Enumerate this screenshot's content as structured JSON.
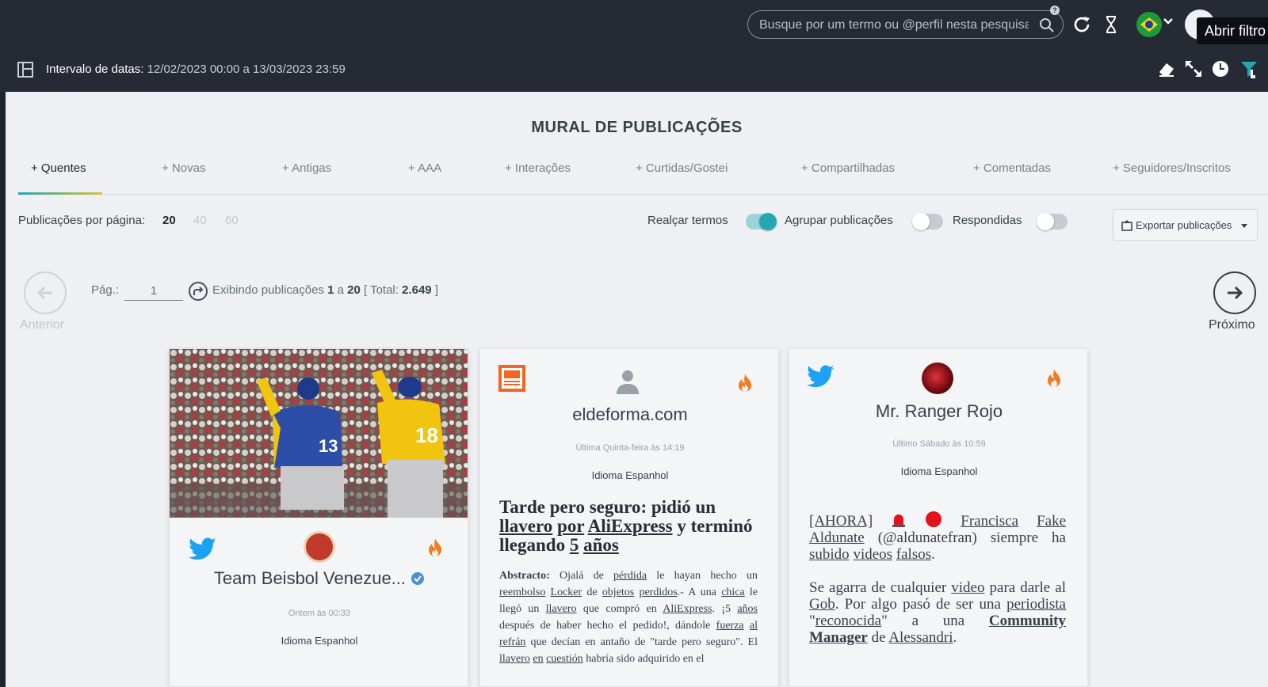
{
  "header": {
    "search_placeholder": "Busque por um termo ou @perfil nesta pesquisa",
    "tooltip": "Abrir filtro",
    "date_label": "Intervalo de datas:",
    "date_range": "12/02/2023 00:00 a 13/03/2023 23:59"
  },
  "main": {
    "title": "MURAL DE PUBLICAÇÕES",
    "tabs": [
      {
        "label": "+ Quentes"
      },
      {
        "label": "+ Novas"
      },
      {
        "label": "+ Antigas"
      },
      {
        "label": "+ AAA"
      },
      {
        "label": "+ Interações"
      },
      {
        "label": "+ Curtidas/Gostei"
      },
      {
        "label": "+ Compartilhadas"
      },
      {
        "label": "+ Comentadas"
      },
      {
        "label": "+ Seguidores/Inscritos"
      }
    ],
    "per_page_label": "Publicações por página:",
    "per_page_options": [
      "20",
      "40",
      "60"
    ],
    "toggles": {
      "highlight": "Realçar termos",
      "group": "Agrupar publicações",
      "replied": "Respondidas"
    },
    "export_label": "Exportar publicações",
    "pager": {
      "prev": "Anterior",
      "next": "Próximo",
      "page_label": "Pág.:",
      "page_value": "1",
      "showing": "Exibindo publicações",
      "from": "1",
      "to_word": "a",
      "to": "20",
      "total_label": "[ Total:",
      "total": "2.649",
      "total_close": "]"
    }
  },
  "cards": [
    {
      "name": "Team Beisbol Venezue...",
      "date": "Ontem às 00:33",
      "language": "Idioma Espanhol",
      "jersey_left": "13",
      "jersey_right": "18"
    },
    {
      "name": "eldeforma.com",
      "date": "Última Quinta-feira às 14:19",
      "language": "Idioma Espanhol"
    },
    {
      "name": "Mr. Ranger Rojo",
      "date": "Último Sábado às 10:59",
      "language": "Idioma Espanhol"
    }
  ],
  "colors": {
    "topbar": "#262a35",
    "accent": "#23a8b1",
    "twitter": "#1da1f2",
    "fire": "#f47b20",
    "rss": "#f26522"
  }
}
